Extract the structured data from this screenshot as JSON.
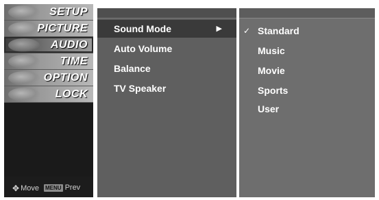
{
  "sidebar": {
    "items": [
      {
        "label": "SETUP",
        "active": false
      },
      {
        "label": "PICTURE",
        "active": false
      },
      {
        "label": "AUDIO",
        "active": true
      },
      {
        "label": "TIME",
        "active": false
      },
      {
        "label": "OPTION",
        "active": false
      },
      {
        "label": "LOCK",
        "active": false
      }
    ],
    "footer": {
      "move_icon": "dpad-icon",
      "move_label": "Move",
      "menu_key_label": "MENU",
      "prev_label": "Prev"
    }
  },
  "submenu": {
    "items": [
      {
        "label": "Sound Mode",
        "active": true,
        "has_arrow": true
      },
      {
        "label": "Auto Volume",
        "active": false,
        "has_arrow": false
      },
      {
        "label": "Balance",
        "active": false,
        "has_arrow": false
      },
      {
        "label": "TV Speaker",
        "active": false,
        "has_arrow": false
      }
    ],
    "arrow_glyph": "▶"
  },
  "options": {
    "check_glyph": "✓",
    "items": [
      {
        "label": "Standard",
        "selected": true
      },
      {
        "label": "Music",
        "selected": false
      },
      {
        "label": "Movie",
        "selected": false
      },
      {
        "label": "Sports",
        "selected": false
      },
      {
        "label": "User",
        "selected": false
      }
    ]
  },
  "colors": {
    "sidebar_bg": "#1a1a1a",
    "mid_panel_bg": "#5f5f5f",
    "right_panel_bg": "#6e6e6e",
    "highlight_bg": "#3a3a3a",
    "text": "#ffffff"
  }
}
